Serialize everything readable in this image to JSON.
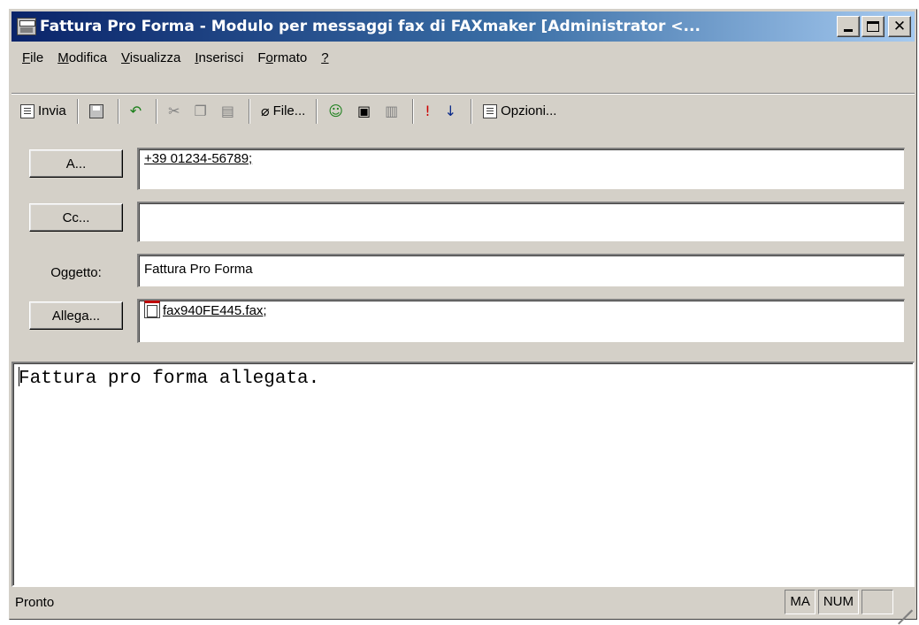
{
  "window": {
    "title": "Fattura Pro Forma - Modulo per messaggi fax di FAXmaker [Administrator <...",
    "app_icon": "fax-machine-icon"
  },
  "menu": [
    {
      "label": "File",
      "underline": "F",
      "rest": "ile"
    },
    {
      "label": "Modifica",
      "underline": "M",
      "rest": "odifica"
    },
    {
      "label": "Visualizza",
      "underline": "V",
      "rest": "isualizza"
    },
    {
      "label": "Inserisci",
      "underline": "I",
      "rest": "nserisci"
    },
    {
      "label": "Formato",
      "pre": "F",
      "underline": "o",
      "rest": "rmato"
    },
    {
      "label": "?",
      "underline": "?",
      "rest": ""
    }
  ],
  "toolbar": {
    "send_label": "Invia",
    "attach_label": "File...",
    "options_label": "Opzioni..."
  },
  "fields": {
    "to_button": "A...",
    "to_value": "+39 01234-56789;",
    "cc_button": "Cc...",
    "cc_value": "",
    "subject_label": "Oggetto:",
    "subject_value": "Fattura Pro Forma",
    "attach_button": "Allega...",
    "attach_value": "fax940FE445.fax;"
  },
  "body_text": "Fattura pro forma allegata.",
  "status": {
    "text": "Pronto",
    "panes": [
      "MA",
      "NUM",
      ""
    ]
  }
}
